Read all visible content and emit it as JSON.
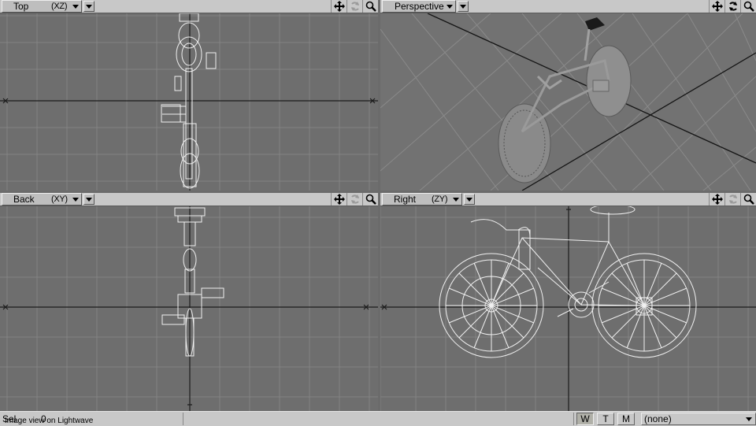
{
  "viewports": {
    "top": {
      "view": "Top",
      "axis": "(XZ)"
    },
    "persp": {
      "view": "Perspective",
      "axis": ""
    },
    "back": {
      "view": "Back",
      "axis": "(XY)"
    },
    "right": {
      "view": "Right",
      "axis": "(ZY)"
    }
  },
  "tool_icons": [
    "move-view-icon",
    "rotate-view-icon",
    "zoom-view-icon"
  ],
  "status": {
    "sel_label": "Sel",
    "sel_count": "0",
    "hint": "Image view on Lightwave",
    "w": "W",
    "t": "T",
    "m": "M",
    "layer": "(none)"
  },
  "colors": {
    "viewport_bg": "#6e6e6e",
    "grid": "#838383",
    "axis": "#1c1c1c",
    "wireframe": "#f0f0f0",
    "header": "#c8c8c8"
  }
}
